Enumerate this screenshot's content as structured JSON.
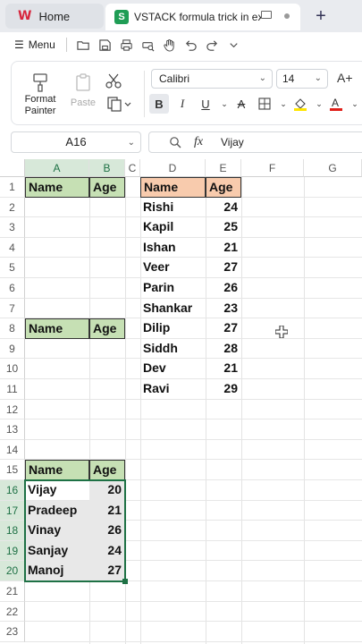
{
  "tabs": {
    "home_label": "Home",
    "doc_label": "VSTACK formula trick in excel",
    "plus": "+"
  },
  "quickbar": {
    "menu_label": "Menu",
    "icons": [
      "folder-open-icon",
      "save-icon",
      "print-icon",
      "print-preview-icon",
      "hand-icon",
      "undo-icon",
      "redo-icon",
      "more-icon"
    ]
  },
  "ribbon": {
    "format_painter_label": "Format Painter",
    "paste_label": "Paste",
    "font_name": "Calibri",
    "font_size": "14",
    "grow_font": "A+"
  },
  "formula_bar": {
    "name_box": "A16",
    "fx": "fx",
    "value": "Vijay"
  },
  "sheet": {
    "columns": [
      "A",
      "B",
      "C",
      "D",
      "E",
      "F",
      "G"
    ],
    "selected_columns": [
      "A",
      "B"
    ],
    "rows": [
      "1",
      "2",
      "3",
      "4",
      "5",
      "6",
      "7",
      "8",
      "9",
      "10",
      "11",
      "12",
      "13",
      "14",
      "15",
      "16",
      "17",
      "18",
      "19",
      "20",
      "21",
      "22",
      "23"
    ],
    "selected_rows": [
      "16",
      "17",
      "18",
      "19",
      "20"
    ],
    "table1": {
      "h_name": "Name",
      "h_age": "Age"
    },
    "table2": {
      "h_name": "Name",
      "h_age": "Age"
    },
    "table3": {
      "h_name": "Name",
      "h_age": "Age",
      "rows": [
        {
          "name": "Vijay",
          "age": "20"
        },
        {
          "name": "Pradeep",
          "age": "21"
        },
        {
          "name": "Vinay",
          "age": "26"
        },
        {
          "name": "Sanjay",
          "age": "24"
        },
        {
          "name": "Manoj",
          "age": "27"
        }
      ]
    },
    "source": {
      "h_name": "Name",
      "h_age": "Age",
      "rows": [
        {
          "name": "Rishi",
          "age": "24"
        },
        {
          "name": "Kapil",
          "age": "25"
        },
        {
          "name": "Ishan",
          "age": "21"
        },
        {
          "name": "Veer",
          "age": "27"
        },
        {
          "name": "Parin",
          "age": "26"
        },
        {
          "name": "Shankar",
          "age": "23"
        },
        {
          "name": "Dilip",
          "age": "27"
        },
        {
          "name": "Siddh",
          "age": "28"
        },
        {
          "name": "Dev",
          "age": "21"
        },
        {
          "name": "Ravi",
          "age": "29"
        }
      ]
    },
    "header_green": "#c6e0b4",
    "header_orange": "#f8cbad",
    "selection_color": "#1e7145"
  }
}
